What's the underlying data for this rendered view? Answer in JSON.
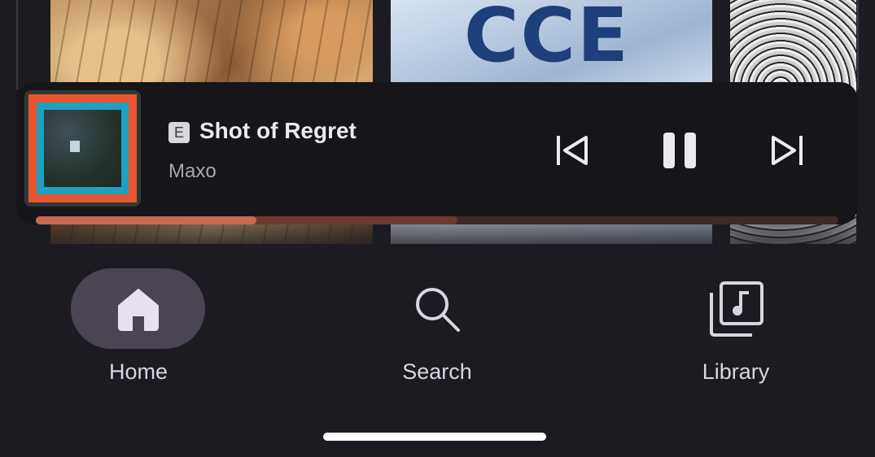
{
  "album_row": {
    "middle_cover_text": "CCE"
  },
  "now_playing": {
    "explicit_badge": "E",
    "title": "Shot of Regret",
    "artist": "Maxo",
    "progress": 0.275,
    "buffered": 0.525,
    "colors": {
      "accent": "#c96a4f",
      "cover_border": "#e85530",
      "cover_frame": "#1fa0c0"
    },
    "controls": {
      "previous": "skip-previous-icon",
      "pause": "pause-icon",
      "next": "skip-next-icon"
    }
  },
  "nav": {
    "items": [
      {
        "label": "Home",
        "icon": "home-icon",
        "active": true
      },
      {
        "label": "Search",
        "icon": "search-icon",
        "active": false
      },
      {
        "label": "Library",
        "icon": "library-icon",
        "active": false
      }
    ]
  }
}
